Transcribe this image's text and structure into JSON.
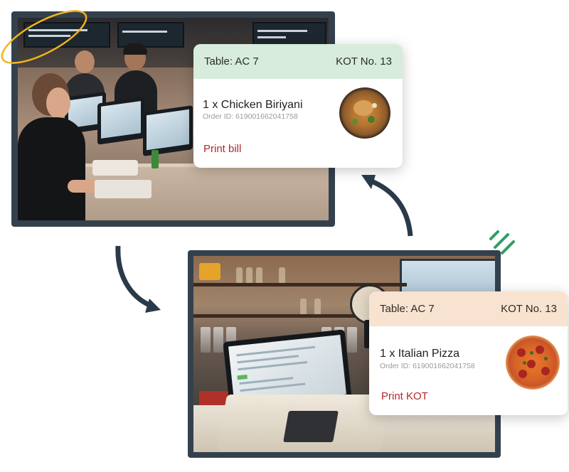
{
  "colors": {
    "frame": "#33414d",
    "kot_header_green": "#d7ecdc",
    "kot_header_peach": "#f8e3d0",
    "action_red": "#b3282d",
    "doodle_yellow": "#f3b51b",
    "doodle_green": "#2e9e63",
    "arrow": "#2a3a4a"
  },
  "kot_cards": [
    {
      "table": "Table: AC 7",
      "kot_number": "KOT No. 13",
      "item": "1 x Chicken Biriyani",
      "order_id": "Order ID: 619001662041758",
      "action": "Print bill",
      "food_icon": "biryani-bowl"
    },
    {
      "table": "Table: AC 7",
      "kot_number": "KOT No. 13",
      "item": "1 x Italian Pizza",
      "order_id": "Order ID: 619001662041758",
      "action": "Print KOT",
      "food_icon": "pizza"
    }
  ]
}
